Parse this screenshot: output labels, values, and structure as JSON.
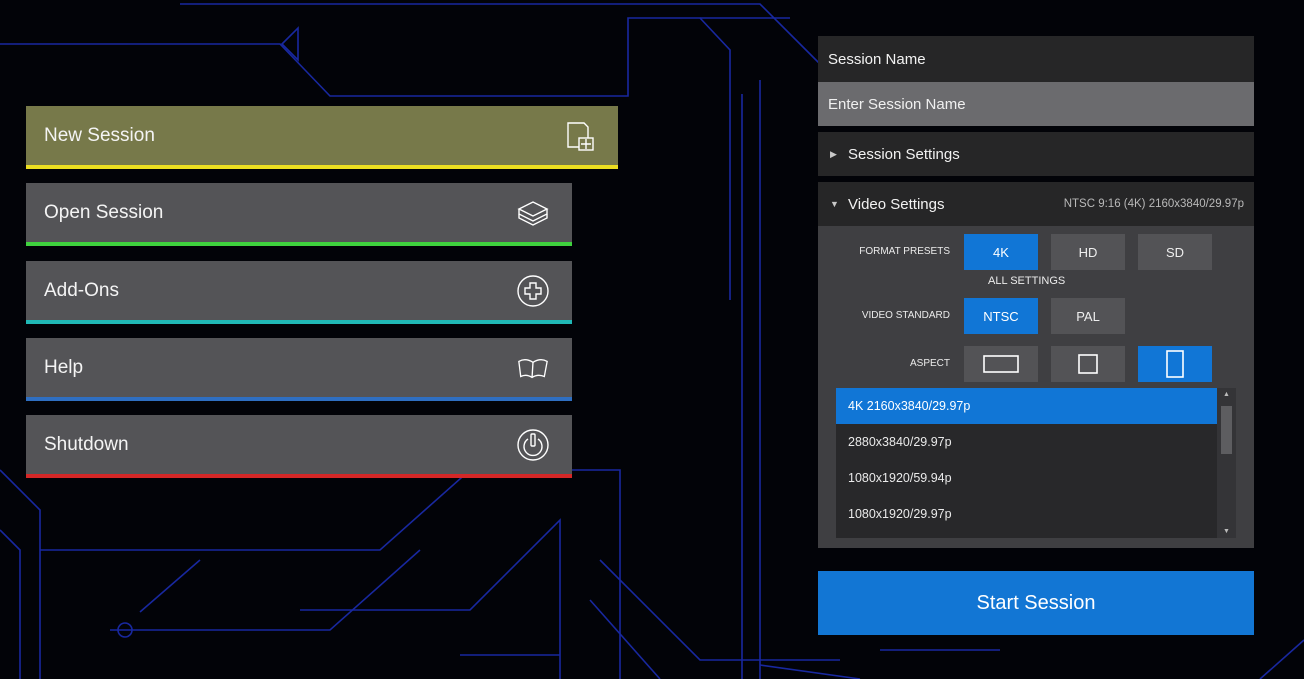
{
  "menu": {
    "new_session": "New Session",
    "open_session": "Open Session",
    "add_ons": "Add-Ons",
    "help": "Help",
    "shutdown": "Shutdown"
  },
  "session": {
    "name_label": "Session Name",
    "name_placeholder": "Enter Session Name",
    "settings_label": "Session Settings"
  },
  "video": {
    "label": "Video Settings",
    "summary": "NTSC 9:16 (4K) 2160x3840/29.97p",
    "format_presets_label": "FORMAT PRESETS",
    "presets": [
      "4K",
      "HD",
      "SD"
    ],
    "all_settings": "ALL SETTINGS",
    "standard_label": "VIDEO STANDARD",
    "standards": [
      "NTSC",
      "PAL"
    ],
    "aspect_label": "ASPECT",
    "resolutions": [
      "4K 2160x3840/29.97p",
      "2880x3840/29.97p",
      "1080x1920/59.94p",
      "1080x1920/29.97p"
    ]
  },
  "start_button": "Start Session",
  "colors": {
    "accent_blue": "#1176d6",
    "new_session_bar": "#ecde21",
    "open_session_bar": "#3fd23e",
    "add_ons_bar": "#20b8b6",
    "help_bar": "#2f6fc2",
    "shutdown_bar": "#d42727"
  },
  "icons": {
    "new_session": "new-document-icon",
    "open_session": "open-box-icon",
    "add_ons": "plus-circle-icon",
    "help": "open-book-icon",
    "shutdown": "power-icon"
  }
}
